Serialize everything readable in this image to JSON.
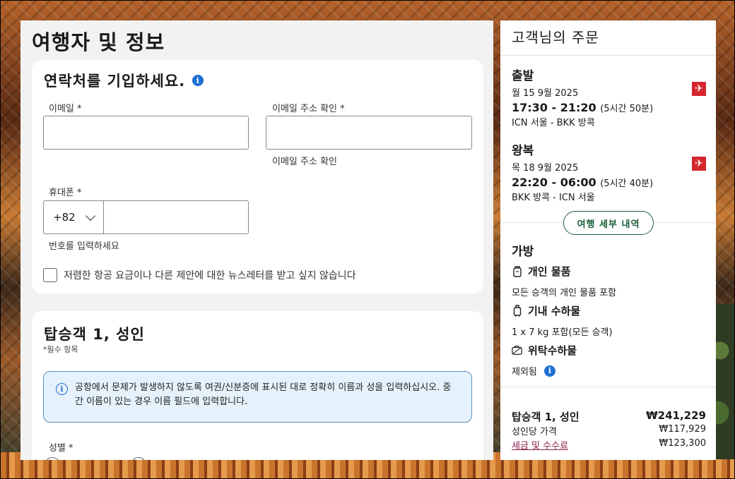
{
  "page": {
    "title": "여행자 및 정보"
  },
  "contact": {
    "title": "연락처를 기입하세요.",
    "email_label": "이메일 *",
    "email_value": "",
    "email_confirm_label": "이메일 주소 확인 *",
    "email_confirm_value": "",
    "email_confirm_helper": "이메일 주소 확인",
    "phone_label": "휴대폰 *",
    "phone_code": "+82",
    "phone_value": "",
    "phone_helper": "번호를 입력하세요",
    "newsletter_label": "저렴한 항공 요금이나 다른 제안에 대한 뉴스레터를 받고 싶지 않습니다"
  },
  "passenger": {
    "title": "탑승객 1, 성인",
    "required_note": "*필수 항목",
    "notice": "공항에서 문제가 발생하지 않도록 여권/신분증에 표시된 대로 정확히 이름과 성을 입력하십시오. 중간 이름이 있는 경우 이름 필드에 입력합니다.",
    "gender_label": "성별 *"
  },
  "summary": {
    "title": "고객님의 주문",
    "outbound": {
      "label": "출발",
      "date": "월 15 9월 2025",
      "times": "17:30 - 21:20",
      "duration": "(5시간 50분)",
      "route": "ICN 서울 - BKK 방콕"
    },
    "return": {
      "label": "왕복",
      "date": "목 18 9월 2025",
      "times": "22:20 - 06:00",
      "duration": "(5시간 40분)",
      "route": "BKK 방콕 - ICN 서울"
    },
    "details_button": "여행 세부 내역",
    "baggage": {
      "title": "가방",
      "personal_title": "개인 물품",
      "personal_desc": "모든 승객의 개인 물품 포함",
      "cabin_title": "기내 수하물",
      "cabin_desc": "1 x 7 kg 포함(모든 승객)",
      "checked_title": "위탁수하물",
      "checked_desc": "제외됨"
    },
    "price": {
      "pax_label": "탑승객 1, 성인",
      "pax_total": "₩241,229",
      "per_adult_label": "성인당 가격",
      "per_adult_value": "₩117,929",
      "tax_label": "세금 및 수수료",
      "tax_value": "₩123,300"
    }
  },
  "colors": {
    "accent_blue": "#1f6fd1",
    "brand_green": "#1b5e3a",
    "airline_red": "#d6262d",
    "link": "#8a1c4a"
  }
}
